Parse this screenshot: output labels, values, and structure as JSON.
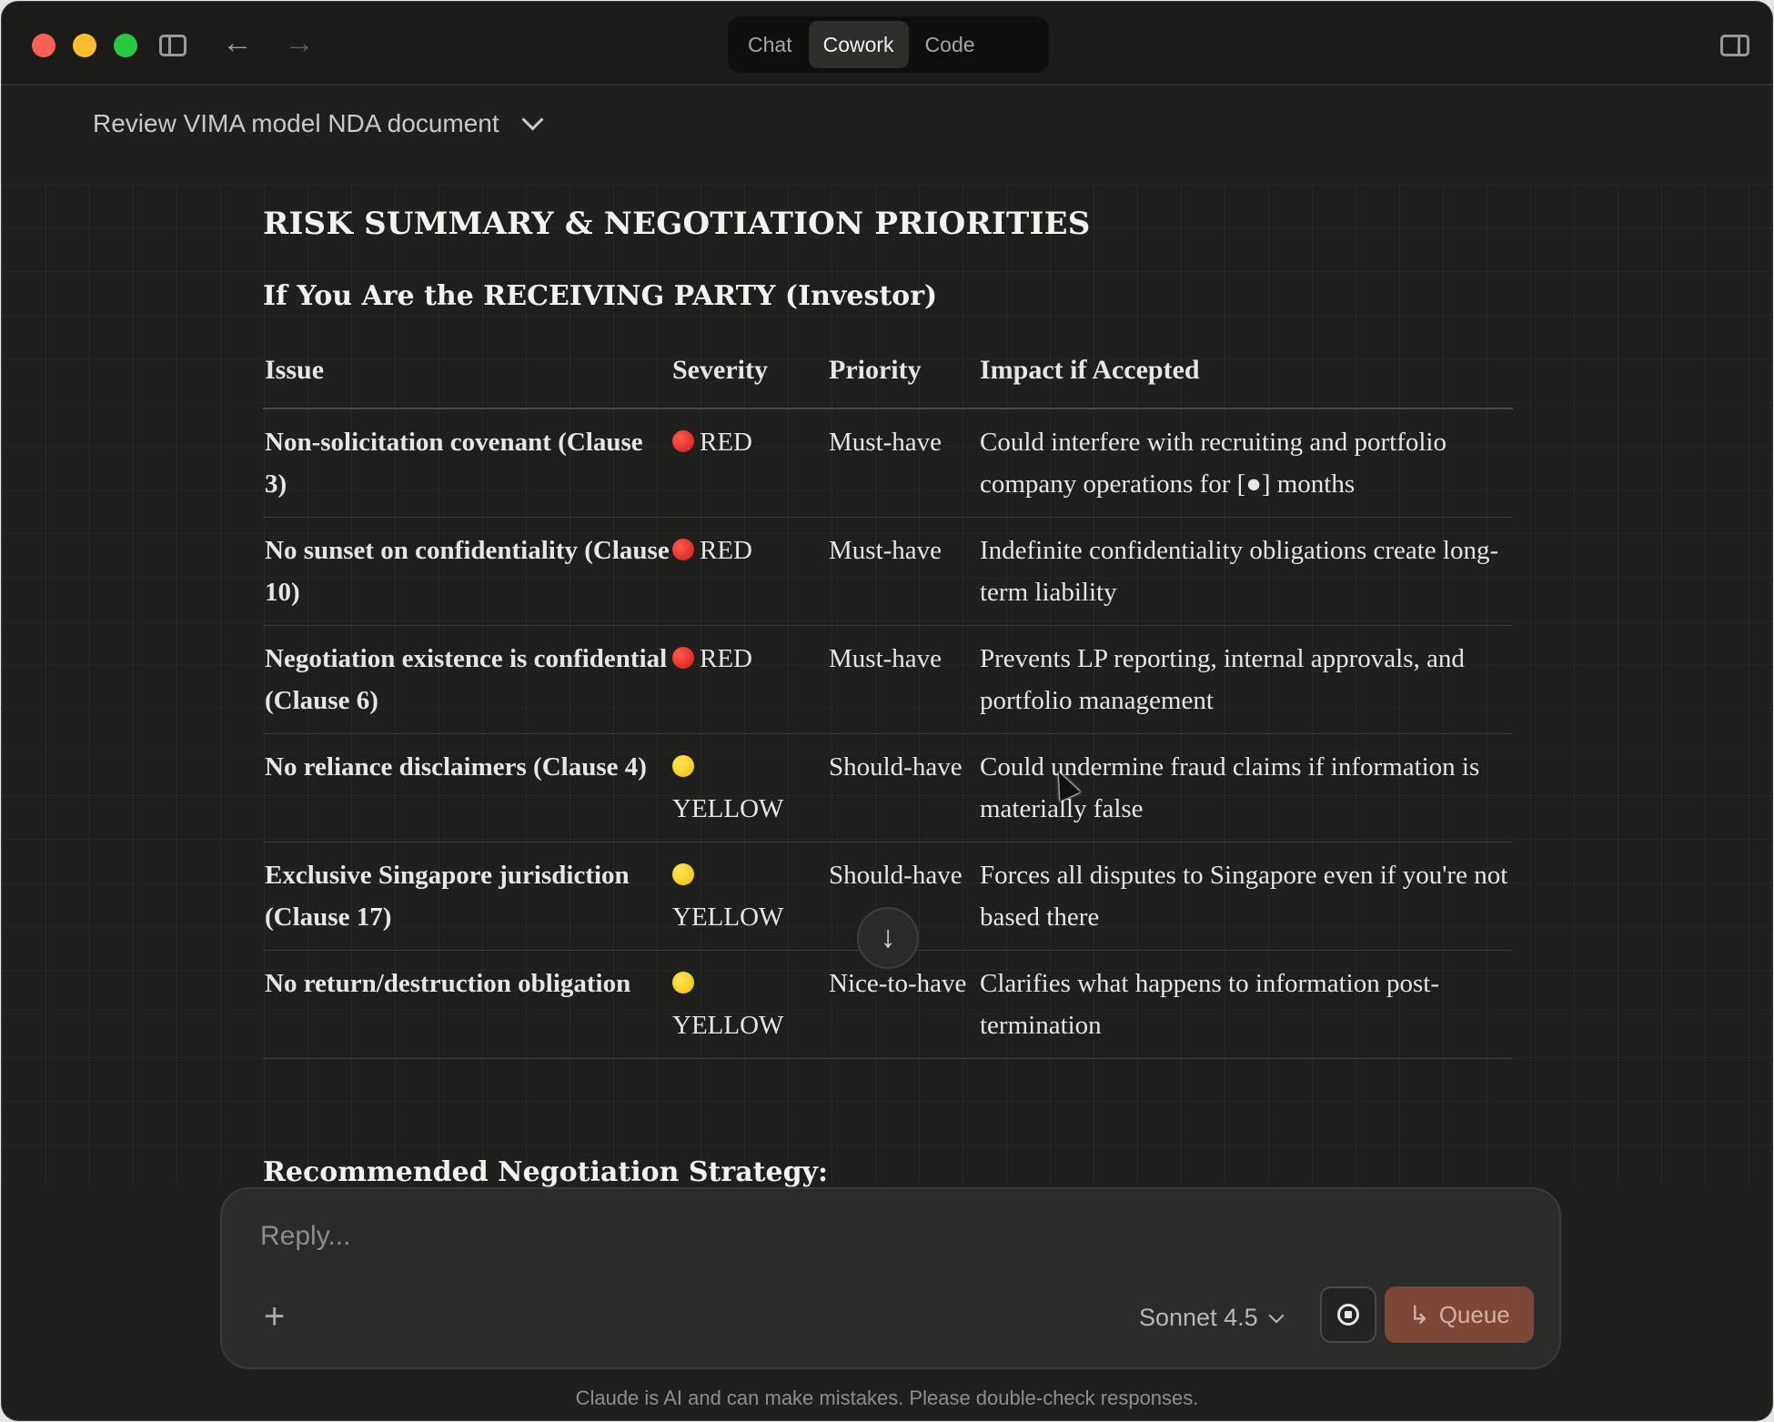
{
  "titlebar": {
    "tabs": [
      {
        "label": "Chat",
        "active": false
      },
      {
        "label": "Cowork",
        "active": true
      },
      {
        "label": "Code",
        "active": false
      }
    ]
  },
  "conversation": {
    "title": "Review VIMA model NDA document"
  },
  "document": {
    "heading": "RISK SUMMARY & NEGOTIATION PRIORITIES",
    "subheading": "If You Are the RECEIVING PARTY (Investor)",
    "table": {
      "headers": [
        "Issue",
        "Severity",
        "Priority",
        "Impact if Accepted"
      ],
      "rows": [
        {
          "issue": "Non-solicitation covenant (Clause 3)",
          "severity": "RED",
          "severity_color": "#e0231a",
          "priority": "Must-have",
          "impact": "Could interfere with recruiting and portfolio company operations for [●] months"
        },
        {
          "issue": "No sunset on confidentiality (Clause 10)",
          "severity": "RED",
          "severity_color": "#e0231a",
          "priority": "Must-have",
          "impact": "Indefinite confidentiality obligations create long-term liability"
        },
        {
          "issue": "Negotiation existence is confidential (Clause 6)",
          "severity": "RED",
          "severity_color": "#e0231a",
          "priority": "Must-have",
          "impact": "Prevents LP reporting, internal approvals, and portfolio management"
        },
        {
          "issue": "No reliance disclaimers (Clause 4)",
          "severity": "YELLOW",
          "severity_color": "#f6c800",
          "priority": "Should-have",
          "impact": "Could undermine fraud claims if information is materially false"
        },
        {
          "issue": "Exclusive Singapore jurisdiction (Clause 17)",
          "severity": "YELLOW",
          "severity_color": "#f6c800",
          "priority": "Should-have",
          "impact": "Forces all disputes to Singapore even if you're not based there"
        },
        {
          "issue": "No return/destruction obligation",
          "severity": "YELLOW",
          "severity_color": "#f6c800",
          "priority": "Nice-to-have",
          "impact": "Clarifies what happens to information post-termination"
        }
      ]
    },
    "next_heading": "Recommended Negotiation Strategy:"
  },
  "composer": {
    "placeholder": "Reply...",
    "model": "Sonnet 4.5",
    "queue_label": "Queue"
  },
  "footer": {
    "disclaimer": "Claude is AI and can make mistakes. Please double-check responses."
  },
  "icons": {
    "sidebar": "sidebar-toggle-icon",
    "back": "arrow-left-icon",
    "forward": "arrow-right-icon",
    "panel": "right-panel-icon",
    "scroll": "arrow-down-icon",
    "add": "plus-icon",
    "stop": "stop-icon",
    "queue": "enter-arrow-icon"
  }
}
